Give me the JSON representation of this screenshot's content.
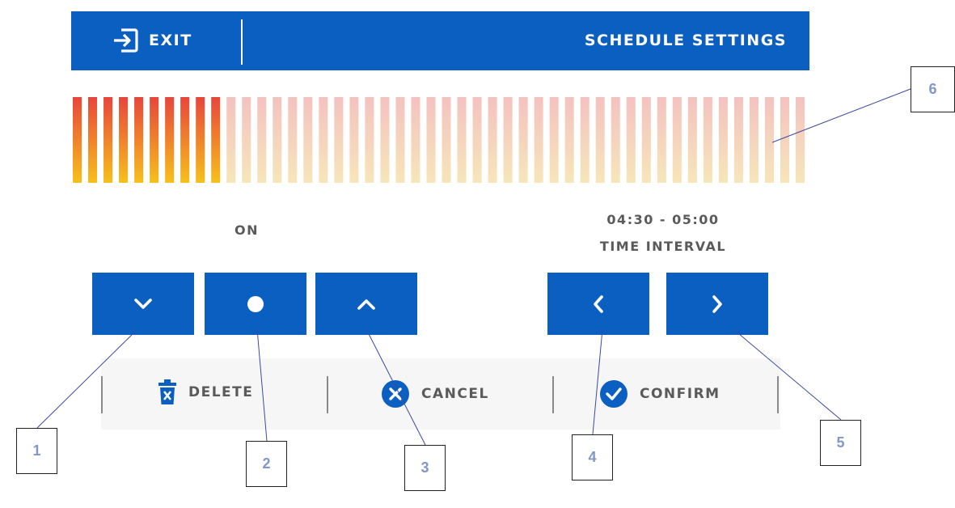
{
  "header": {
    "exit_label": "EXIT",
    "title": "SCHEDULE SETTINGS",
    "background_color": "#0b5fc0"
  },
  "timeline": {
    "total_slots": 48,
    "active_slots": 10,
    "active_gradient": [
      "#e8453c",
      "#f7c01b"
    ],
    "inactive_gradient": [
      "#f4c2c0",
      "#f6e6ba"
    ]
  },
  "status": {
    "state": "ON"
  },
  "interval": {
    "range": "04:30 - 05:00",
    "label": "TIME INTERVAL"
  },
  "controls": {
    "down_icon": "chevron-down-icon",
    "toggle_icon": "dot-icon",
    "up_icon": "chevron-up-icon",
    "prev_icon": "chevron-left-icon",
    "next_icon": "chevron-right-icon"
  },
  "actions": {
    "delete_label": "DELETE",
    "cancel_label": "CANCEL",
    "confirm_label": "CONFIRM"
  },
  "callouts": [
    "1",
    "2",
    "3",
    "4",
    "5",
    "6"
  ]
}
